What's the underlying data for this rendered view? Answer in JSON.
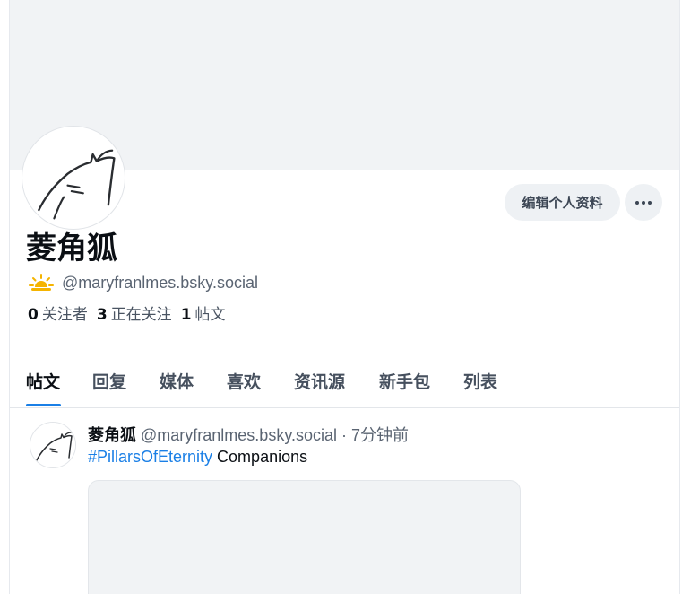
{
  "profile": {
    "display_name": "菱角狐",
    "handle": "@maryfranlmes.bsky.social",
    "edit_button": "编辑个人资料",
    "more_icon": "ellipsis-icon",
    "status_icon": "sun-behind-cloud-icon"
  },
  "stats": {
    "followers_count": "0",
    "followers_label": "关注者",
    "following_count": "3",
    "following_label": "正在关注",
    "posts_count": "1",
    "posts_label": "帖文"
  },
  "tabs": [
    {
      "label": "帖文",
      "active": true
    },
    {
      "label": "回复"
    },
    {
      "label": "媒体"
    },
    {
      "label": "喜欢"
    },
    {
      "label": "资讯源"
    },
    {
      "label": "新手包"
    },
    {
      "label": "列表"
    }
  ],
  "post": {
    "author": "菱角狐",
    "handle": "@maryfranlmes.bsky.social",
    "separator": "·",
    "time": "7分钟前",
    "hashtag": "#PillarsOfEternity",
    "text": " Companions"
  },
  "colors": {
    "accent": "#1a7fe6",
    "banner": "#f1f3f5",
    "button_bg": "#eef1f4"
  }
}
